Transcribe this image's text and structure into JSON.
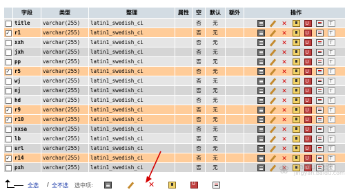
{
  "headers": [
    "字段",
    "类型",
    "整理",
    "属性",
    "空",
    "默认",
    "额外",
    "操作"
  ],
  "rows": [
    {
      "name": "title",
      "type": "varchar(255)",
      "collation": "latin1_swedish_ci",
      "null": "否",
      "default": "无",
      "checked": false,
      "selected": false
    },
    {
      "name": "r1",
      "type": "varchar(255)",
      "collation": "latin1_swedish_ci",
      "null": "否",
      "default": "无",
      "checked": true,
      "selected": true
    },
    {
      "name": "xxh",
      "type": "varchar(255)",
      "collation": "latin1_swedish_ci",
      "null": "否",
      "default": "无",
      "checked": false,
      "selected": false
    },
    {
      "name": "jxh",
      "type": "varchar(255)",
      "collation": "latin1_swedish_ci",
      "null": "否",
      "default": "无",
      "checked": false,
      "selected": false
    },
    {
      "name": "pp",
      "type": "varchar(255)",
      "collation": "latin1_swedish_ci",
      "null": "否",
      "default": "无",
      "checked": false,
      "selected": false
    },
    {
      "name": "r5",
      "type": "varchar(255)",
      "collation": "latin1_swedish_ci",
      "null": "否",
      "default": "无",
      "checked": true,
      "selected": true
    },
    {
      "name": "wj",
      "type": "varchar(255)",
      "collation": "latin1_swedish_ci",
      "null": "否",
      "default": "无",
      "checked": false,
      "selected": false
    },
    {
      "name": "nj",
      "type": "varchar(255)",
      "collation": "latin1_swedish_ci",
      "null": "否",
      "default": "无",
      "checked": false,
      "selected": false
    },
    {
      "name": "hd",
      "type": "varchar(255)",
      "collation": "latin1_swedish_ci",
      "null": "否",
      "default": "无",
      "checked": false,
      "selected": false
    },
    {
      "name": "r9",
      "type": "varchar(255)",
      "collation": "latin1_swedish_ci",
      "null": "否",
      "default": "无",
      "checked": true,
      "selected": true
    },
    {
      "name": "r10",
      "type": "varchar(255)",
      "collation": "latin1_swedish_ci",
      "null": "否",
      "default": "无",
      "checked": true,
      "selected": true
    },
    {
      "name": "xxsa",
      "type": "varchar(255)",
      "collation": "latin1_swedish_ci",
      "null": "否",
      "default": "无",
      "checked": false,
      "selected": false
    },
    {
      "name": "lb",
      "type": "varchar(255)",
      "collation": "latin1_swedish_ci",
      "null": "否",
      "default": "无",
      "checked": false,
      "selected": false
    },
    {
      "name": "url",
      "type": "varchar(255)",
      "collation": "latin1_swedish_ci",
      "null": "否",
      "default": "无",
      "checked": false,
      "selected": false
    },
    {
      "name": "r14",
      "type": "varchar(255)",
      "collation": "latin1_swedish_ci",
      "null": "否",
      "default": "无",
      "checked": true,
      "selected": true
    },
    {
      "name": "pxh",
      "type": "varchar(255)",
      "collation": "latin1_swedish_ci",
      "null": "否",
      "default": "无",
      "checked": false,
      "selected": false
    }
  ],
  "footer": {
    "check_all": "全选",
    "separator": "/",
    "uncheck_all": "全不选",
    "with_selected": "选中项:"
  },
  "colors": {
    "header_bg": "#d3dce3",
    "row_light": "#e5e5e5",
    "row_dark": "#d5d5d5",
    "row_selected": "#ffcc99",
    "link": "#1a3aa8",
    "annotation_arrow": "#d40000"
  },
  "icons": [
    "browse-icon",
    "edit-icon",
    "drop-icon",
    "primary-key-icon",
    "unique-icon",
    "index-icon",
    "fulltext-icon"
  ]
}
